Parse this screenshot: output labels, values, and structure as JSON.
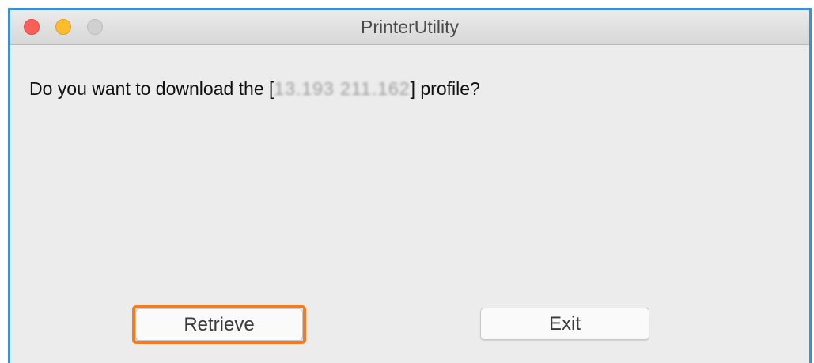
{
  "window": {
    "title": "PrinterUtility"
  },
  "dialog": {
    "message_prefix": "Do you want to download the [",
    "ip_address": "13.193 211.162",
    "message_suffix": "] profile?"
  },
  "buttons": {
    "retrieve_label": "Retrieve",
    "exit_label": "Exit"
  },
  "colors": {
    "frame_border": "#3d8fd9",
    "highlight": "#f47b20",
    "close_light": "#fc5f57",
    "minimize_light": "#fdbc2e",
    "zoom_light": "#d0d0d0",
    "window_background": "#ececec"
  }
}
